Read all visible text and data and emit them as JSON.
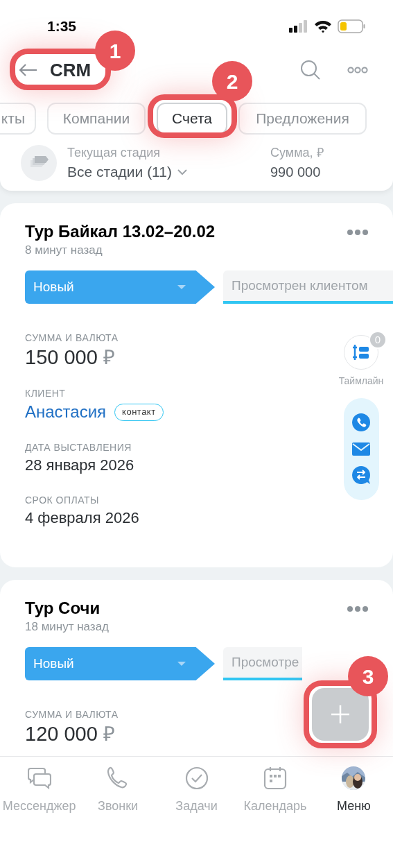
{
  "status_bar": {
    "time": "1:35"
  },
  "header": {
    "title": "CRM"
  },
  "tabs": [
    {
      "label": "кты",
      "selected": false
    },
    {
      "label": "Компании",
      "selected": false
    },
    {
      "label": "Счета",
      "selected": true
    },
    {
      "label": "Предложения",
      "selected": false
    }
  ],
  "summary": {
    "stage_label": "Текущая стадия",
    "stage_value": "Все стадии (11)",
    "sum_label": "Сумма, ₽",
    "sum_value": "990 000"
  },
  "cards": [
    {
      "title": "Тур Байкал 13.02–20.02",
      "time": "8 минут назад",
      "stages": [
        {
          "label": "Новый",
          "kind": "current"
        },
        {
          "label": "Просмотрен клиентом",
          "kind": "next"
        }
      ],
      "fields": [
        {
          "kind": "amount",
          "label": "СУММА И ВАЛЮТА",
          "value": "150 000",
          "currency": "₽"
        },
        {
          "kind": "contact",
          "label": "КЛИЕНТ",
          "value": "Анастасия",
          "badge": "контакт"
        },
        {
          "kind": "text",
          "label": "ДАТА ВЫСТАВЛЕНИЯ",
          "value": "28 января 2026"
        },
        {
          "kind": "text",
          "label": "СРОК ОПЛАТЫ",
          "value": "4 февраля 2026"
        }
      ],
      "timeline": {
        "label": "Таймлайн",
        "count": "0"
      },
      "actions": true
    },
    {
      "title": "Тур Сочи",
      "time": "18 минут назад",
      "stages": [
        {
          "label": "Новый",
          "kind": "current"
        },
        {
          "label": "Просмотре",
          "kind": "next"
        }
      ],
      "fields": [
        {
          "kind": "amount",
          "label": "СУММА И ВАЛЮТА",
          "value": "120 000",
          "currency": "₽"
        }
      ],
      "actions": false
    }
  ],
  "callouts": [
    "1",
    "2",
    "3"
  ],
  "nav": [
    {
      "kind": "chat",
      "label": "Мессенджер",
      "selected": false
    },
    {
      "kind": "phone",
      "label": "Звонки",
      "selected": false
    },
    {
      "kind": "tasks",
      "label": "Задачи",
      "selected": false
    },
    {
      "kind": "calendar",
      "label": "Календарь",
      "selected": false
    },
    {
      "kind": "avatar",
      "label": "Меню",
      "selected": true
    }
  ]
}
